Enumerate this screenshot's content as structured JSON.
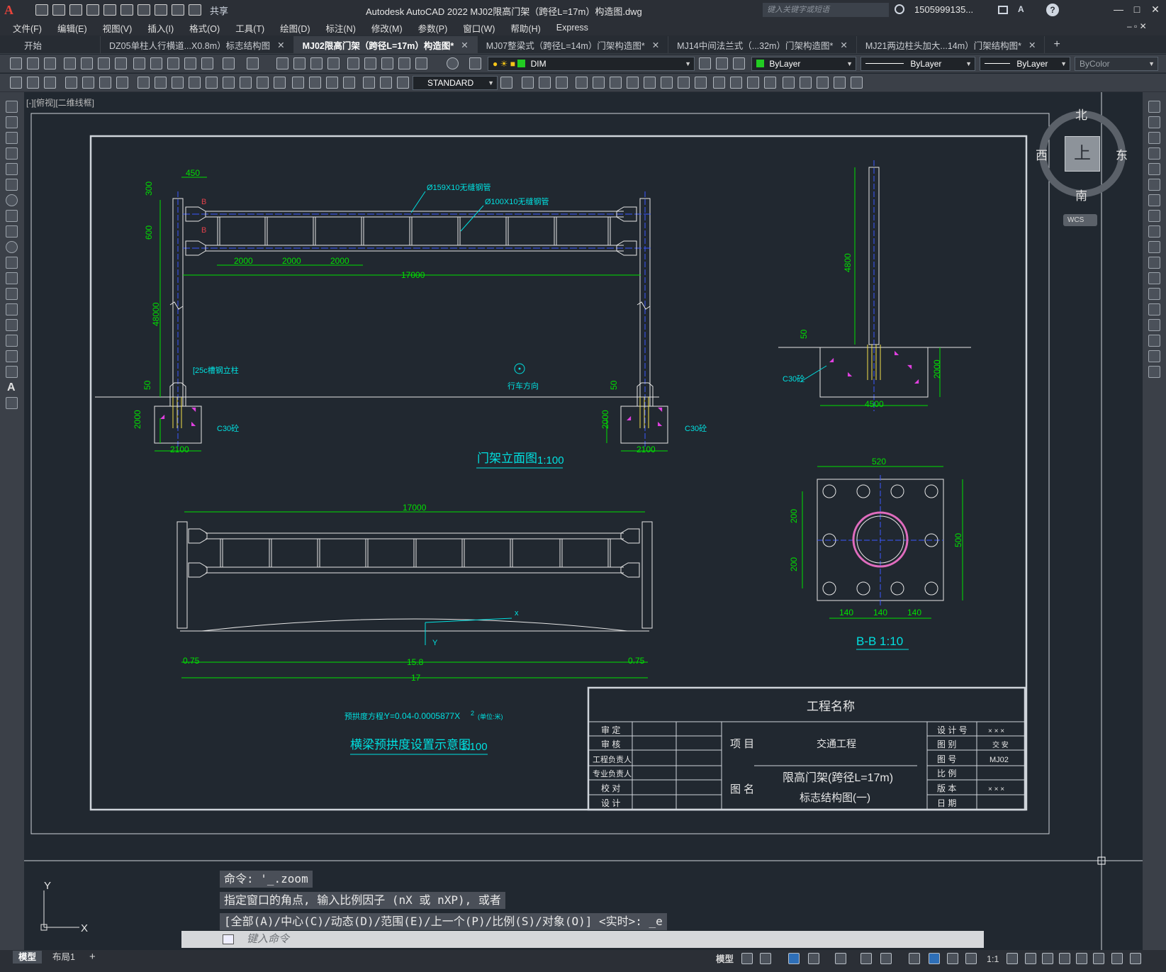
{
  "titlebar": {
    "app_logo": "A",
    "share_label": "共享",
    "title": "Autodesk AutoCAD 2022    MJ02限高门架（跨径L=17m）构造图.dwg",
    "search_placeholder": "键入关键字或短语",
    "user": "1505999135...",
    "help_icon": "?"
  },
  "menu": [
    "文件(F)",
    "编辑(E)",
    "视图(V)",
    "插入(I)",
    "格式(O)",
    "工具(T)",
    "绘图(D)",
    "标注(N)",
    "修改(M)",
    "参数(P)",
    "窗口(W)",
    "帮助(H)",
    "Express"
  ],
  "tabs": [
    {
      "label": "开始"
    },
    {
      "label": "DZ05单柱人行横道...X0.8m）标志结构图"
    },
    {
      "label": "MJ02限高门架（跨径L=17m）构造图*"
    },
    {
      "label": "MJ07整梁式（跨径L=14m）门架构造图*"
    },
    {
      "label": "MJ14中间法兰式（...32m）门架构造图*"
    },
    {
      "label": "MJ21两边柱头加大...14m）门架结构图*"
    }
  ],
  "toolbar": {
    "dim_style": "DIM",
    "layer": "ByLayer",
    "linetype": "ByLayer",
    "lineweight": "ByLayer",
    "color": "ByColor",
    "text_style": "STANDARD"
  },
  "viewport_label": "[-][俯视][二维线框]",
  "viewcube": {
    "north": "北",
    "south": "南",
    "east": "东",
    "west": "西",
    "top": "上",
    "wcs": "WCS"
  },
  "drawing": {
    "elevation": {
      "dims_top": "450",
      "dim_300": "300",
      "dim_600": "600",
      "dim_48000": "48000",
      "dim_50_left": "50",
      "dim_2000_left": "2000",
      "dim_2100_left": "2100",
      "dim_50_right": "50",
      "dim_2000_right": "2000",
      "dim_2100_right": "2100",
      "span_2000_a": "2000",
      "span_2000_b": "2000",
      "span_2000_c": "2000",
      "span_17000": "17000",
      "label_pipe_big": "Ø159X10无缝钢管",
      "label_pipe_small": "Ø100X10无缝钢管",
      "label_column": "[25c槽钢立柱",
      "label_c30_left": "C30砼",
      "label_c30_right": "C30砼",
      "label_direction": "行车方向",
      "section_mark_b1": "B",
      "section_mark_b2": "B",
      "title": "门架立面图",
      "scale": "1:100"
    },
    "side": {
      "dim_4800": "4800",
      "dim_50": "50",
      "dim_2000": "2000",
      "dim_4500": "4500",
      "label_c30": "C30砼"
    },
    "plate": {
      "dim_520": "520",
      "dim_200a": "200",
      "dim_200b": "200",
      "dim_500": "500",
      "dim_140a": "140",
      "dim_140b": "140",
      "dim_140c": "140",
      "title": "B-B 1:10"
    },
    "camber": {
      "dim_17000": "17000",
      "dim_075_left": "0.75",
      "dim_158": "15.8",
      "dim_075_right": "0.75",
      "dim_17": "17",
      "axis_x": "x",
      "axis_y": "Y",
      "equation_label": "预拱度方程:",
      "equation": "Y=0.04-0.0005877X",
      "equation_exp": "2",
      "equation_unit": "(单位:米)",
      "title": "横梁预拱度设置示意图",
      "scale": "1:100"
    },
    "titleblock": {
      "project_name_label": "工程名称",
      "roles": [
        "审  定",
        "审  核",
        "工程负责人",
        "专业负责人",
        "校  对",
        "设  计"
      ],
      "item_label": "项  目",
      "item_value": "交通工程",
      "name_label": "图  名",
      "name_line1": "限高门架(跨径L=17m)",
      "name_line2": "标志结构图(一)",
      "right_labels": [
        "设 计 号",
        "图  别",
        "图  号",
        "比  例",
        "版  本",
        "日  期"
      ],
      "right_values": [
        "× × ×",
        "交 安",
        "MJ02",
        "",
        "× × ×",
        ""
      ]
    }
  },
  "command": {
    "line1": "命令: '_.zoom",
    "line2": "指定窗口的角点, 输入比例因子 (nX 或 nXP), 或者",
    "line3": "[全部(A)/中心(C)/动态(D)/范围(E)/上一个(P)/比例(S)/对象(O)] <实时>: _e",
    "input_placeholder": "键入命令"
  },
  "ucs": {
    "x": "X",
    "y": "Y"
  },
  "status": {
    "tab_model": "模型",
    "tab_layout": "布局1",
    "add_tab": "+",
    "model_label": "模型",
    "scale": "1:1"
  }
}
